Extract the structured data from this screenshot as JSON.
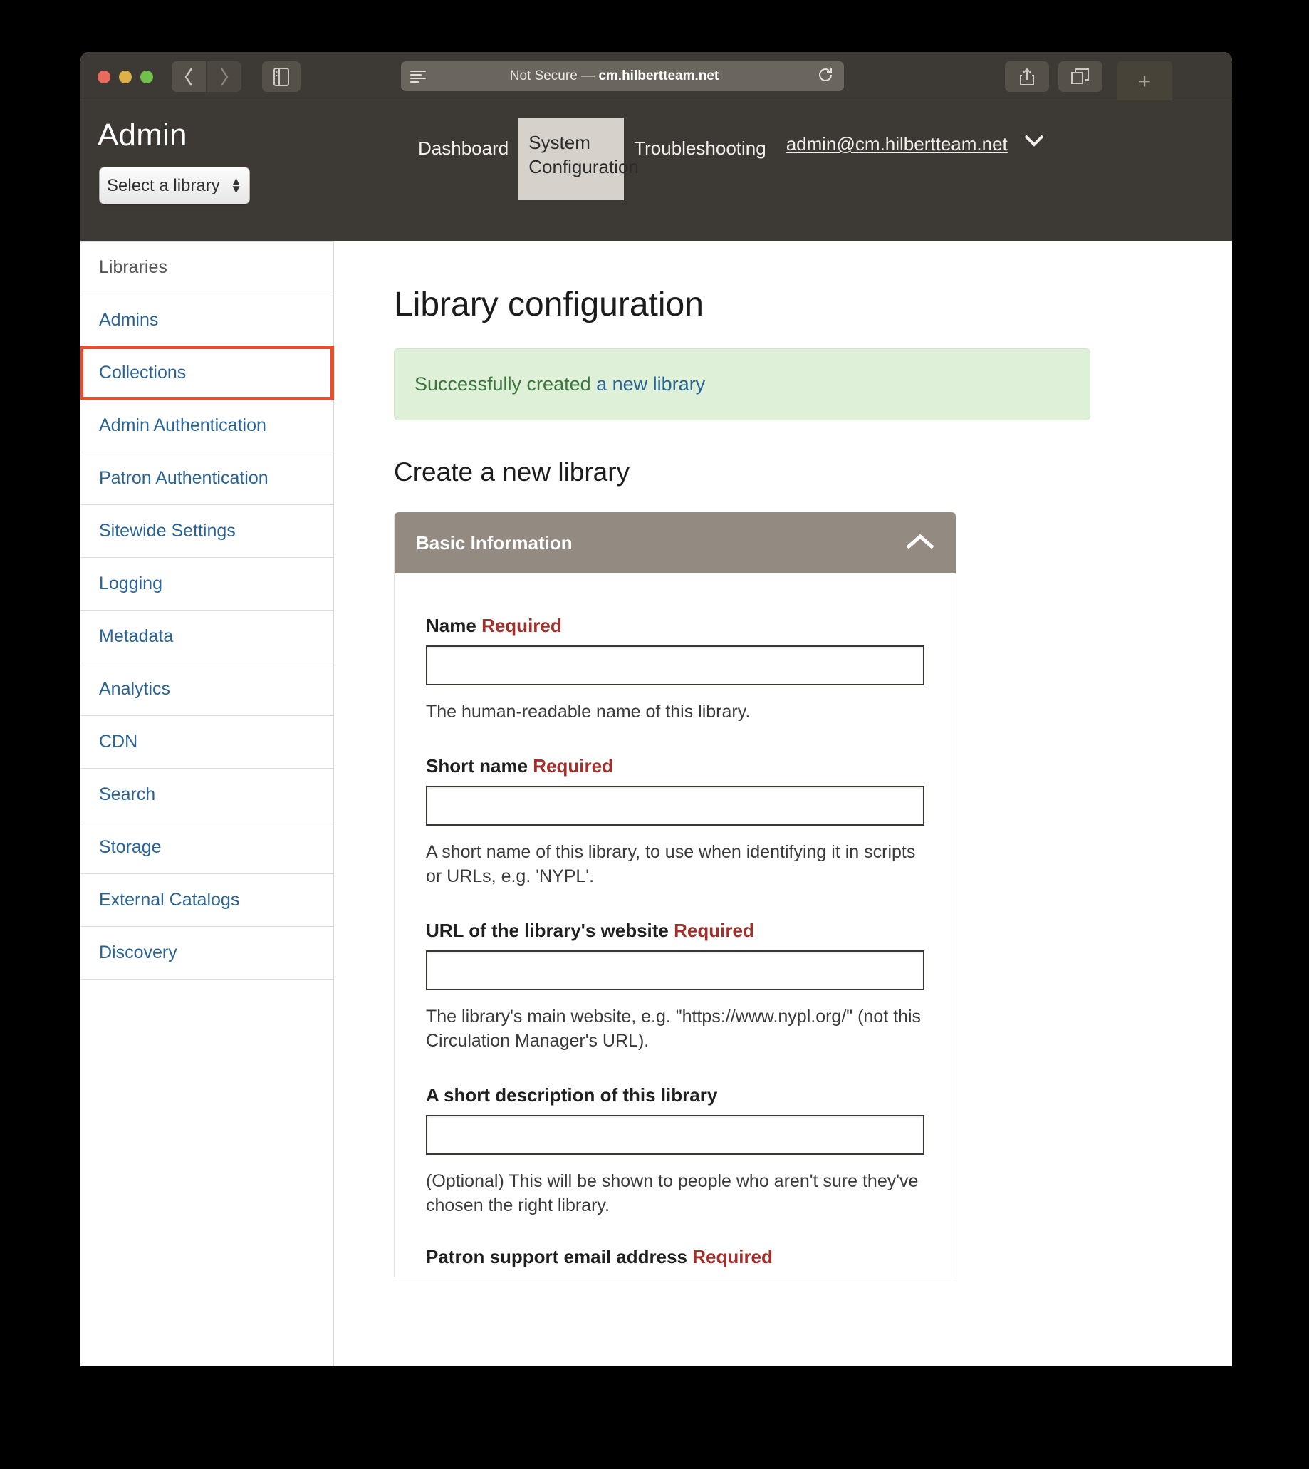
{
  "browser": {
    "url_prefix": "Not Secure — ",
    "url_host": "cm.hilbertteam.net",
    "back_icon": "chevron-left-icon",
    "forward_icon": "chevron-right-icon",
    "sidebar_icon": "sidebar-toggle-icon",
    "reader_icon": "reader-view-icon",
    "reload_icon": "reload-icon",
    "share_icon": "share-icon",
    "tabs_icon": "tab-overview-icon",
    "newtab_label": "+"
  },
  "header": {
    "app_title": "Admin",
    "library_select": {
      "value": "Select a library",
      "stepper_icon": "stepper-up-down-icon"
    },
    "nav": [
      {
        "label": "Dashboard",
        "active": false
      },
      {
        "label": "System Configuration",
        "active": true
      },
      {
        "label": "Troubleshooting",
        "active": false
      }
    ],
    "user": {
      "email": "admin@cm.hilbertteam.net",
      "chevron_icon": "chevron-down-icon"
    }
  },
  "sidebar": {
    "items": [
      {
        "label": "Libraries"
      },
      {
        "label": "Admins"
      },
      {
        "label": "Collections"
      },
      {
        "label": "Admin Authentication"
      },
      {
        "label": "Patron Authentication"
      },
      {
        "label": "Sitewide Settings"
      },
      {
        "label": "Logging"
      },
      {
        "label": "Metadata"
      },
      {
        "label": "Analytics"
      },
      {
        "label": "CDN"
      },
      {
        "label": "Search"
      },
      {
        "label": "Storage"
      },
      {
        "label": "External Catalogs"
      },
      {
        "label": "Discovery"
      }
    ],
    "current_index": 0,
    "highlighted_index": 2
  },
  "main": {
    "page_title": "Library configuration",
    "alert": {
      "text": "Successfully created ",
      "link_text": "a new library"
    },
    "section_title": "Create a new library",
    "panel": {
      "title": "Basic Information",
      "chevron_icon": "chevron-up-icon"
    },
    "fields": [
      {
        "label": "Name",
        "required_label": "Required",
        "value": "",
        "placeholder": "",
        "help": "The human-readable name of this library."
      },
      {
        "label": "Short name",
        "required_label": "Required",
        "value": "",
        "placeholder": "",
        "help": "A short name of this library, to use when identifying it in scripts or URLs, e.g. 'NYPL'."
      },
      {
        "label": "URL of the library's website",
        "required_label": "Required",
        "value": "",
        "placeholder": "",
        "help": "The library's main website, e.g. \"https://www.nypl.org/\" (not this Circulation Manager's URL)."
      },
      {
        "label": "A short description of this library",
        "required_label": "",
        "value": "",
        "placeholder": "",
        "help": "(Optional) This will be shown to people who aren't sure they've chosen the right library."
      },
      {
        "label": "Patron support email address",
        "required_label": "Required",
        "value": "",
        "placeholder": "",
        "help": ""
      }
    ]
  },
  "colors": {
    "chrome": "#3d3a36",
    "link": "#2a6496",
    "accent_highlight": "#f04b23",
    "panel_header": "#938b82",
    "alert_bg": "#dff0d8",
    "alert_text": "#3c763d",
    "required": "#a1302b"
  }
}
